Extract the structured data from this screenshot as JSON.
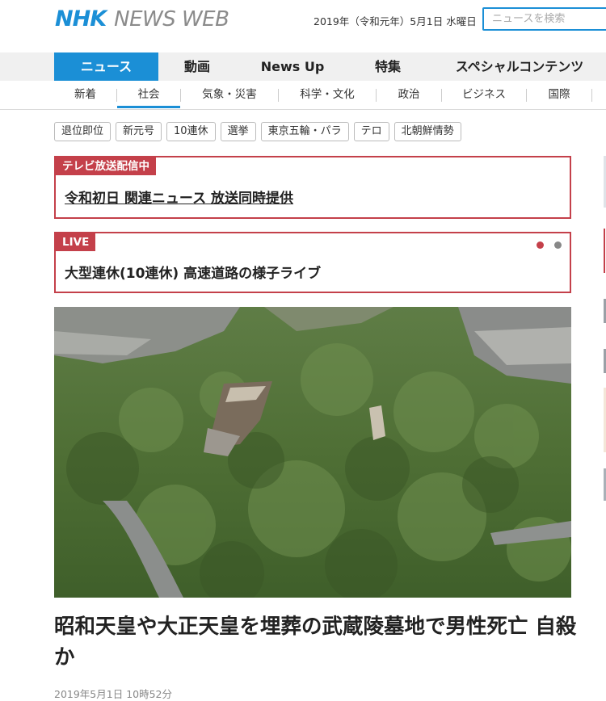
{
  "header": {
    "logo_nhk": "NHK",
    "logo_newsweb": "NEWS WEB",
    "date": "2019年（令和元年）5月1日 水曜日",
    "search_placeholder": "ニュースを検索"
  },
  "main_nav": [
    {
      "label": "ニュース",
      "active": true
    },
    {
      "label": "動画"
    },
    {
      "label": "News Up"
    },
    {
      "label": "特集"
    },
    {
      "label": "スペシャルコンテンツ"
    }
  ],
  "sub_nav": [
    {
      "label": "新着"
    },
    {
      "label": "社会",
      "active": true
    },
    {
      "label": "気象・災害"
    },
    {
      "label": "科学・文化"
    },
    {
      "label": "政治"
    },
    {
      "label": "ビジネス"
    },
    {
      "label": "国際"
    }
  ],
  "tags": [
    "退位即位",
    "新元号",
    "10連休",
    "選挙",
    "東京五輪・パラ",
    "テロ",
    "北朝鮮情勢"
  ],
  "broadcast": {
    "label": "テレビ放送配信中",
    "link": "令和初日 関連ニュース 放送同時提供"
  },
  "live": {
    "label": "LIVE",
    "title": "大型連休(10連休) 高速道路の様子ライブ",
    "carousel_active_color": "#c4404a",
    "carousel_inactive_color": "#888888"
  },
  "article": {
    "image_alt": "aerial-forest-photo",
    "headline": "昭和天皇や大正天皇を埋葬の武蔵陵墓地で男性死亡 自殺か",
    "timestamp": "2019年5月1日 10時52分"
  },
  "colors": {
    "brand_blue": "#1b8fd6",
    "alert_red": "#c4404a"
  }
}
